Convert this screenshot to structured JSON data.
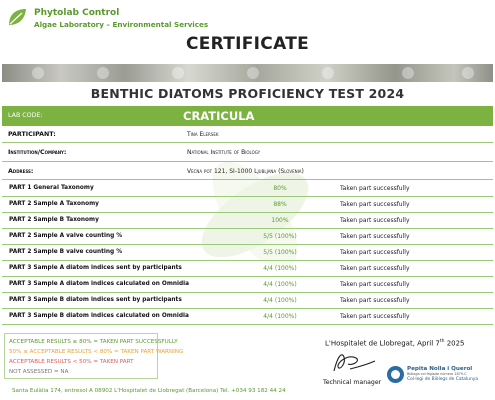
{
  "header": {
    "brand_name": "Phytolab Control",
    "brand_subtitle": "Algae Laboratory – Environmental Services",
    "certificate_title": "CERTIFICATE"
  },
  "test_title": "BENTHIC DIATOMS PROFICIENCY TEST 2024",
  "lab": {
    "label": "LAB CODE:",
    "value": "CRATICULA"
  },
  "info": [
    {
      "label": "PARTICIPANT:",
      "value": "Tina Elersek"
    },
    {
      "label": "Institution/Company:",
      "value": "National Institute of Biology"
    },
    {
      "label": "Address:",
      "value": "Vecna pot 121, SI-1000 Ljubljana (Slovenia)"
    }
  ],
  "parts": [
    {
      "label": "PART 1 General Taxonomy",
      "value": "80%",
      "comment": "Taken part successfully"
    },
    {
      "label": "PART 2 Sample A Taxonomy",
      "value": "88%",
      "comment": "Taken part successfully"
    },
    {
      "label": "PART 2 Sample B Taxonomy",
      "value": "100%",
      "comment": "Taken part successfully"
    },
    {
      "label": "PART 2 Sample A valve counting %",
      "value": "5/5 (100%)",
      "comment": "Taken part successfully"
    },
    {
      "label": "PART 2 Sample B valve counting %",
      "value": "5/5 (100%)",
      "comment": "Taken part successfully"
    },
    {
      "label": "PART 3 Sample A diatom indices sent by participants",
      "value": "4/4 (100%)",
      "comment": "Taken part successfully"
    },
    {
      "label": "PART 3 Sample A diatom indices calculated on Omnidia",
      "value": "4/4 (100%)",
      "comment": "Taken part successfully"
    },
    {
      "label": "PART 3 Sample B diatom indices sent by participants",
      "value": "4/4 (100%)",
      "comment": "Taken part successfully"
    },
    {
      "label": "PART 3 Sample B diatom indices calculated on Omnidia",
      "value": "4/4 (100%)",
      "comment": "Taken part successfully"
    }
  ],
  "legend": {
    "accept": "ACCEPTABLE RESULTS ≥ 80% = TAKEN PART SUCCESSFULLY",
    "warning": "50% ≤ ACCEPTABLE RESULTS < 80% = TAKEN PART WARNING",
    "reject": "ACCEPTABLE RESULTS < 50% = TAKEN PART",
    "na": "NOT ASSESSED = NA"
  },
  "signature": {
    "place_date_prefix": "L'Hospitalet de Llobregat, April 7",
    "place_date_sup": "th",
    "place_date_year": " 2025",
    "signer_title": "Technical manager"
  },
  "college": {
    "line1": "Pepita Nolla i Querol",
    "line2": "Biòloga col·legiada número 1879-C",
    "line3": "Col·legi de Biòlegs de Catalunya"
  },
  "footer": "Santa Eulàlia 174, entresol A 08902 L'Hospitalet de Llobregat (Barcelona)     Tel. +034 93 182 44 24",
  "colors": {
    "brand_green": "#7cb241",
    "text_green": "#5a9a2e",
    "warning_orange": "#e8a336",
    "reject_red": "#e05a5a"
  }
}
